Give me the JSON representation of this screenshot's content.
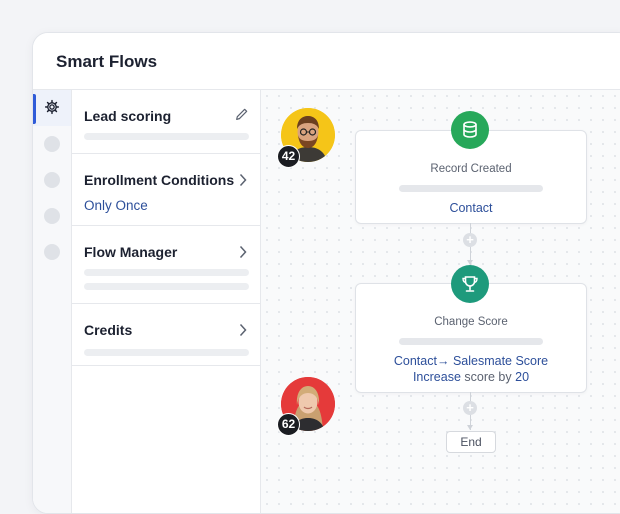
{
  "app": {
    "title": "Smart Flows"
  },
  "sidebar": {
    "active_icon": "gear-icon",
    "items": [
      "gear-icon",
      "dot",
      "dot",
      "dot",
      "dot"
    ]
  },
  "panel": {
    "sections": [
      {
        "title": "Lead scoring",
        "action_icon": "pencil-icon"
      },
      {
        "title": "Enrollment Conditions",
        "value": "Only Once",
        "action_icon": "chevron-right-icon"
      },
      {
        "title": "Flow Manager",
        "action_icon": "chevron-right-icon"
      },
      {
        "title": "Credits",
        "action_icon": "chevron-right-icon"
      }
    ]
  },
  "flow": {
    "trigger": {
      "label": "Record Created",
      "link": "Contact",
      "icon": "database-icon",
      "color": "#27a85a"
    },
    "action": {
      "label": "Change Score",
      "line1_a": "Contact",
      "line1_arrow": "→",
      "line1_b": "Salesmate Score",
      "line2_a": "Increase",
      "line2_mid": "score by",
      "line2_b": "20",
      "icon": "trophy-icon",
      "color": "#1e9a7c"
    },
    "end": {
      "label": "End"
    },
    "add_icon": "+"
  },
  "contacts": [
    {
      "score": "42",
      "ring_color": "#f5c518"
    },
    {
      "score": "62",
      "ring_color": "#e53a3a"
    }
  ],
  "colors": {
    "accent": "#2f5bd8",
    "link": "#2d4f9a"
  }
}
